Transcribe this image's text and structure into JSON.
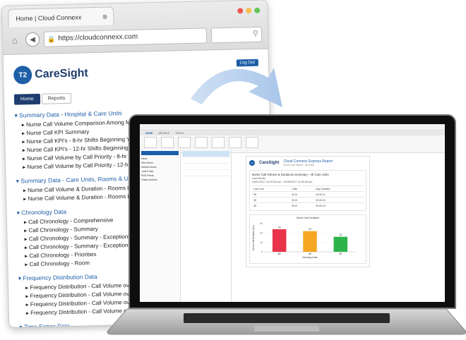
{
  "browser": {
    "tab_title": "Home | Cloud Connexx",
    "url": "https://cloudconnexx.com",
    "logo": {
      "brand": "CareSight"
    },
    "logout_label": "Log Out",
    "page_tabs": [
      "Home",
      "Reports"
    ],
    "sections": [
      {
        "title": "Summary Data - Hospital & Care Units",
        "items": [
          "Nurse Call Volume Comparison Among Main Units",
          "Nurse Call KPI Summary",
          "Nurse Call KPI's - 8-hr Shifts Beginning Yesterday & Ending",
          "Nurse Call KPI's - 12-hr Shifts Beginning Yesterday & Endir",
          "Nurse Call Volume by Call Priority - 8-hr Shifts Beginning",
          "Nurse Call Volume by Call Priority - 12-hr Shifts Beginning"
        ]
      },
      {
        "title": "Summary Data - Care Units, Rooms & Units",
        "items": [
          "Nurse Call Volume & Duration - Rooms Level - Prior Day Sh",
          "Nurse Call Volume & Duration - Rooms Level - Prior Night"
        ]
      },
      {
        "title": "Chronology Data",
        "items": [
          "Call Chronology - Comprehensive",
          "Call Chronology - Summary",
          "Call Chronology - Summary - Exceptions - All Priorities",
          "Call Chronology - Summary - Exceptions - Bed Exit Toilet",
          "Call Chronology - Priorities",
          "Call Chronology - Room"
        ]
      },
      {
        "title": "Frequency Distribution Data",
        "items": [
          "Frequency Distribution - Call Volume over 24-hr Daily C",
          "Frequency Distribution - Call Volume over 24-hr Daily C",
          "Frequency Distribution - Call Volume over Duration Tim",
          "Frequency Distribution - Call Volume over Duration Tim"
        ]
      },
      {
        "title": "Time Series Data",
        "items": [
          "Time Series - Call Volume",
          "Time Series - Average Call Duration (Sec)"
        ]
      }
    ]
  },
  "email": {
    "tabs": [
      "HOME",
      "ARCHIVE",
      "TOOLS"
    ],
    "folders": [
      "Inbox",
      "Sent Items",
      "Deleted Items",
      "Junk Email",
      "RSS Feeds",
      "Online Archive"
    ],
    "report": {
      "brand": "CareSight",
      "title": "Cloud Connexx Express Report",
      "subtitle": "Nurse Call Report - All Units",
      "summary_title": "Nurse Call Volume & Durations Summary - All Care Units",
      "period": "Last Month",
      "range": "04/01/2017 12:00:00 am - 04/30/2017 11:59:59 pm",
      "table": {
        "headers": [
          "Care Unit",
          "Calls",
          "Avg Duration"
        ],
        "rows": [
          [
            "5E",
            "5213",
            "00:00:21"
          ],
          [
            "4E",
            "5213",
            "00:00:24"
          ],
          [
            "3E",
            "5213",
            "00:00:19"
          ]
        ]
      }
    }
  },
  "chart_data": {
    "type": "bar",
    "title": "Nurse Call Durations",
    "xlabel": "Nursing Units",
    "ylabel": "Nurse Call Duration (sec)",
    "categories": [
      "5E",
      "4E",
      "3E"
    ],
    "values": [
      24,
      22,
      16
    ],
    "colors": [
      "#e8334a",
      "#f5a623",
      "#2db34a"
    ],
    "ylim": [
      0,
      30
    ]
  }
}
